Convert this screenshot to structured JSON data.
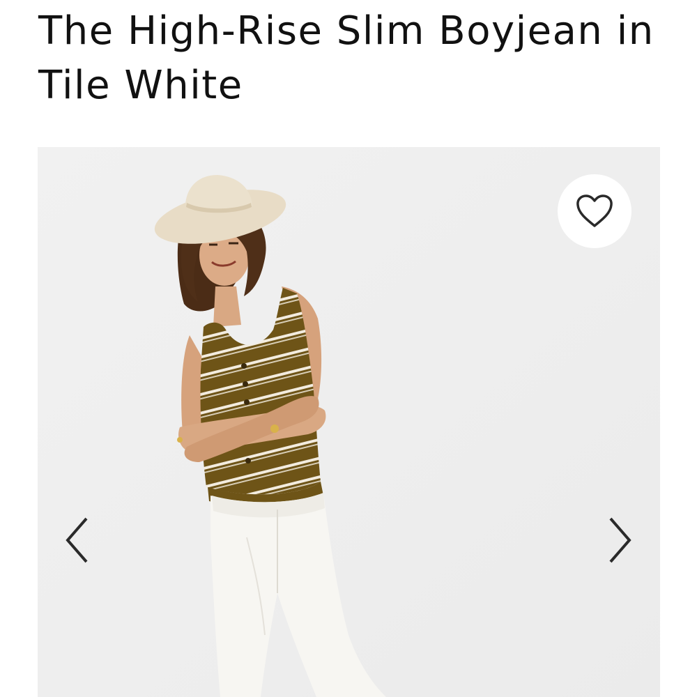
{
  "product": {
    "title": "The High-Rise Slim Boyjean in Tile White"
  },
  "gallery": {
    "favorite_icon": "heart-outline-icon",
    "prev_icon": "chevron-left-icon",
    "next_icon": "chevron-right-icon"
  },
  "colors": {
    "background": "#ffffff",
    "photo_backdrop": "#efefef",
    "text": "#111111",
    "icon": "#2a2a2a",
    "top_stripe_brown": "#6e5417",
    "jeans_white": "#f7f6f2",
    "hat_straw": "#e8dcc6"
  }
}
